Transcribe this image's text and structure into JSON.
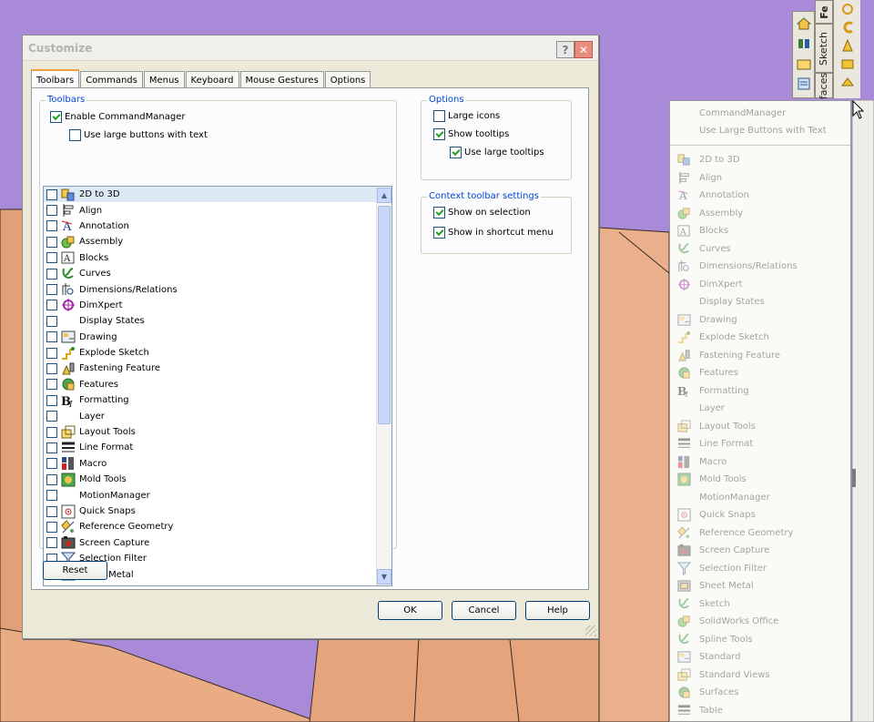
{
  "dialog": {
    "title": "Customize",
    "help_glyph": "?",
    "close_glyph": "✕",
    "tabs": [
      "Toolbars",
      "Commands",
      "Menus",
      "Keyboard",
      "Mouse Gestures",
      "Options"
    ],
    "toolbars_group": {
      "legend": "Toolbars",
      "enable_commandmanager": "Enable CommandManager",
      "use_large_buttons_text": "Use large buttons with text"
    },
    "toolbar_items": [
      {
        "label": "2D to 3D",
        "icon": "2d-to-3d-icon",
        "selected": true
      },
      {
        "label": "Align",
        "icon": "align-icon"
      },
      {
        "label": "Annotation",
        "icon": "annotation-icon"
      },
      {
        "label": "Assembly",
        "icon": "assembly-icon"
      },
      {
        "label": "Blocks",
        "icon": "blocks-icon"
      },
      {
        "label": "Curves",
        "icon": "curves-icon"
      },
      {
        "label": "Dimensions/Relations",
        "icon": "dimensions-icon"
      },
      {
        "label": "DimXpert",
        "icon": "dimxpert-icon"
      },
      {
        "label": "Display States",
        "icon": ""
      },
      {
        "label": "Drawing",
        "icon": "drawing-icon"
      },
      {
        "label": "Explode Sketch",
        "icon": "explode-sketch-icon"
      },
      {
        "label": "Fastening Feature",
        "icon": "fastening-feature-icon"
      },
      {
        "label": "Features",
        "icon": "features-icon"
      },
      {
        "label": "Formatting",
        "icon": "formatting-icon"
      },
      {
        "label": "Layer",
        "icon": ""
      },
      {
        "label": "Layout Tools",
        "icon": "layout-tools-icon"
      },
      {
        "label": "Line Format",
        "icon": "line-format-icon"
      },
      {
        "label": "Macro",
        "icon": "macro-icon"
      },
      {
        "label": "Mold Tools",
        "icon": "mold-tools-icon"
      },
      {
        "label": "MotionManager",
        "icon": ""
      },
      {
        "label": "Quick Snaps",
        "icon": "quick-snaps-icon"
      },
      {
        "label": "Reference Geometry",
        "icon": "reference-geometry-icon"
      },
      {
        "label": "Screen Capture",
        "icon": "screen-capture-icon"
      },
      {
        "label": "Selection Filter",
        "icon": "selection-filter-icon"
      },
      {
        "label": "Sheet Metal",
        "icon": "sheet-metal-icon"
      }
    ],
    "options_group": {
      "legend": "Options",
      "large_icons": "Large icons",
      "show_tooltips": "Show tooltips",
      "use_large_tooltips": "Use large tooltips"
    },
    "context_group": {
      "legend": "Context toolbar settings",
      "show_on_selection": "Show on selection",
      "show_in_shortcut_menu": "Show in shortcut menu"
    },
    "reset_label": "Reset",
    "ok_label": "OK",
    "cancel_label": "Cancel",
    "help_label": "Help"
  },
  "command_tabs": {
    "features": "Fe",
    "sketch": "Sketch",
    "surfaces": "faces"
  },
  "context_menu": {
    "header_items": [
      "CommandManager",
      "Use Large Buttons with Text"
    ],
    "items": [
      "2D to 3D",
      "Align",
      "Annotation",
      "Assembly",
      "Blocks",
      "Curves",
      "Dimensions/Relations",
      "DimXpert",
      "Display States",
      "Drawing",
      "Explode Sketch",
      "Fastening Feature",
      "Features",
      "Formatting",
      "Layer",
      "Layout Tools",
      "Line Format",
      "Macro",
      "Mold Tools",
      "MotionManager",
      "Quick Snaps",
      "Reference Geometry",
      "Screen Capture",
      "Selection Filter",
      "Sheet Metal",
      "Sketch",
      "SolidWorks Office",
      "Spline Tools",
      "Standard",
      "Standard Views",
      "Surfaces",
      "Table"
    ]
  },
  "colors": {
    "background": "#a889d8",
    "model_face": "#e6a47c",
    "legend_blue": "#0046d5",
    "close_button": "#e98c7d"
  }
}
